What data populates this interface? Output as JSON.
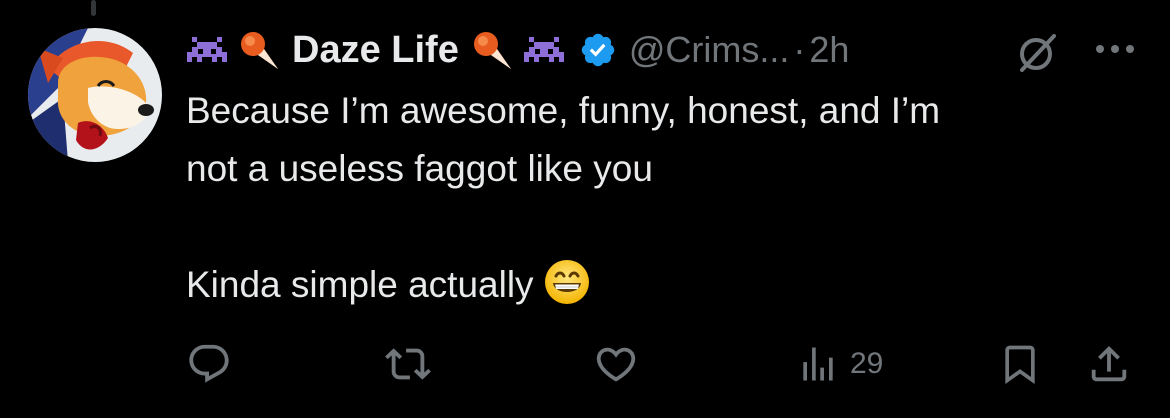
{
  "post": {
    "author": {
      "display_name": "Daze Life",
      "handle": "@Crims...",
      "verified": true,
      "verified_color": "#1d9bf0",
      "name_emojis_left": [
        "space-invader-icon",
        "comet-icon"
      ],
      "name_emojis_right": [
        "comet-icon",
        "space-invader-icon"
      ]
    },
    "separator": "·",
    "timestamp": "2h",
    "text_line_1": "Because I’m awesome, funny, honest, and I’m",
    "text_line_2": "not a useless faggot like you",
    "text_line_3": "Kinda simple actually",
    "trailing_emoji": "grinning-face-icon",
    "metrics": {
      "views": "29"
    },
    "actions": [
      "reply-icon",
      "repost-icon",
      "like-icon",
      "views-icon",
      "bookmark-icon",
      "share-icon"
    ]
  },
  "colors": {
    "background": "#000000",
    "text": "#e7e9ea",
    "secondary": "#71767b",
    "accent": "#1d9bf0"
  }
}
